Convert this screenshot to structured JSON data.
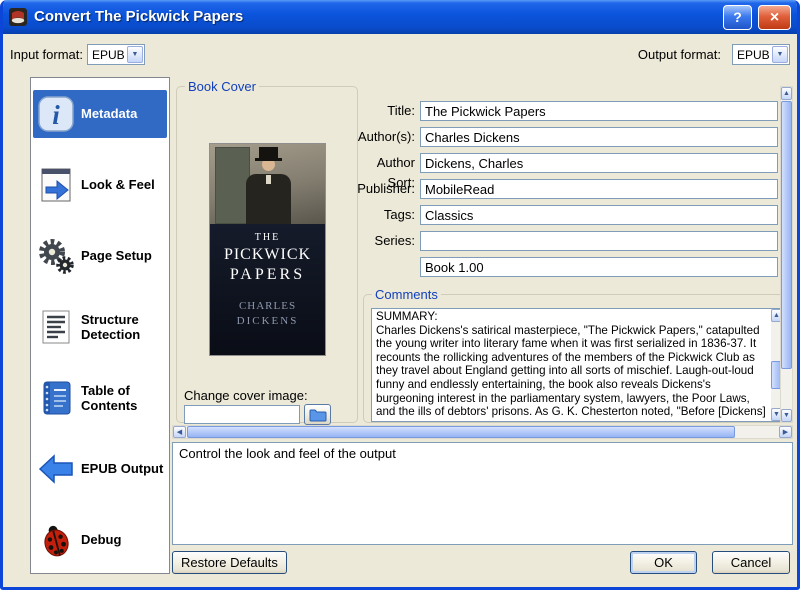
{
  "titlebar": {
    "title": "Convert The Pickwick Papers",
    "help_label": "?",
    "close_label": "×"
  },
  "format_bar": {
    "input_label": "Input format:",
    "input_value": "EPUB",
    "output_label": "Output format:",
    "output_value": "EPUB"
  },
  "sidebar": {
    "items": [
      {
        "label": "Metadata",
        "icon": "info-icon",
        "selected": true
      },
      {
        "label": "Look & Feel",
        "icon": "page-arrow-icon",
        "selected": false
      },
      {
        "label": "Page Setup",
        "icon": "gears-icon",
        "selected": false
      },
      {
        "label": "Structure Detection",
        "icon": "document-lines-icon",
        "selected": false
      },
      {
        "label": "Table of Contents",
        "icon": "notebook-icon",
        "selected": false
      },
      {
        "label": "EPUB Output",
        "icon": "left-arrow-icon",
        "selected": false
      },
      {
        "label": "Debug",
        "icon": "ladybug-icon",
        "selected": false
      }
    ]
  },
  "book_cover": {
    "group_label": "Book Cover",
    "cover_text": {
      "title_small": "THE",
      "title_line1": "PICKWICK",
      "title_line2": "PAPERS",
      "author_line1": "CHARLES",
      "author_line2": "DICKENS"
    },
    "change_cover_label": "Change cover image:",
    "cover_path_value": ""
  },
  "metadata_form": {
    "title_label": "Title:",
    "title_value": "The Pickwick Papers",
    "authors_label": "Author(s):",
    "authors_value": "Charles Dickens",
    "author_sort_label": "Author Sort:",
    "author_sort_value": "Dickens, Charles",
    "publisher_label": "Publisher:",
    "publisher_value": "MobileRead",
    "tags_label": "Tags:",
    "tags_value": "Classics",
    "series_label": "Series:",
    "series_value": "",
    "series_index_value": "Book 1.00"
  },
  "comments": {
    "group_label": "Comments",
    "text": "SUMMARY:\nCharles Dickens's satirical masterpiece, \"The Pickwick Papers,\" catapulted the young writer into literary fame when it was first serialized in 1836-37. It recounts the rollicking adventures of the members of the Pickwick Club as they travel about England getting into all sorts of mischief. Laugh-out-loud funny and endlessly entertaining, the book also reveals Dickens's burgeoning interest in the parliamentary system, lawyers, the Poor Laws, and the ills of debtors' prisons. As G. K. Chesterton noted, \"Before [Dickens] wrote a single real story, he had a kind of vision . . . a map full of fantastic"
  },
  "status_box": {
    "text": "Control the look and feel of the output"
  },
  "action_buttons": {
    "restore_defaults": "Restore Defaults",
    "ok": "OK",
    "cancel": "Cancel"
  },
  "colors": {
    "titlebar_blue": "#0b54dc",
    "dialog_bg": "#ece9d8",
    "selection_blue": "#316ac5",
    "group_label_blue": "#1240bc",
    "input_border": "#7f9db9"
  }
}
